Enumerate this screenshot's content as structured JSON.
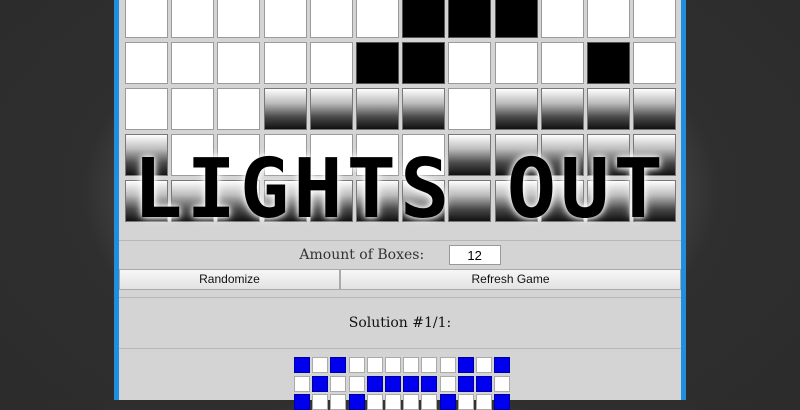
{
  "title": "LIGHTS OUT",
  "grid": {
    "rows": [
      [
        0,
        0,
        0,
        0,
        0,
        0,
        1,
        1,
        1,
        0,
        0,
        0
      ],
      [
        0,
        0,
        0,
        0,
        0,
        1,
        1,
        0,
        0,
        0,
        1,
        0
      ],
      [
        0,
        0,
        0,
        2,
        2,
        2,
        2,
        0,
        2,
        2,
        2,
        2
      ],
      [
        2,
        0,
        0,
        0,
        0,
        0,
        0,
        2,
        2,
        2,
        2,
        2
      ],
      [
        2,
        2,
        2,
        2,
        2,
        2,
        2,
        2,
        2,
        2,
        2,
        2
      ]
    ]
  },
  "controls": {
    "amount_label": "Amount of Boxes:",
    "amount_value": "12",
    "randomize_label": "Randomize",
    "refresh_label": "Refresh Game"
  },
  "solution": {
    "label": "Solution #1/1:",
    "rows": [
      [
        1,
        0,
        1,
        0,
        0,
        0,
        0,
        0,
        0,
        1,
        0,
        1
      ],
      [
        0,
        1,
        0,
        0,
        1,
        1,
        1,
        1,
        0,
        1,
        1,
        0
      ],
      [
        1,
        0,
        0,
        1,
        0,
        0,
        0,
        0,
        1,
        0,
        0,
        1
      ]
    ]
  },
  "colors": {
    "accent_border": "#1e8ee0",
    "solution_on": "#0000ee"
  }
}
